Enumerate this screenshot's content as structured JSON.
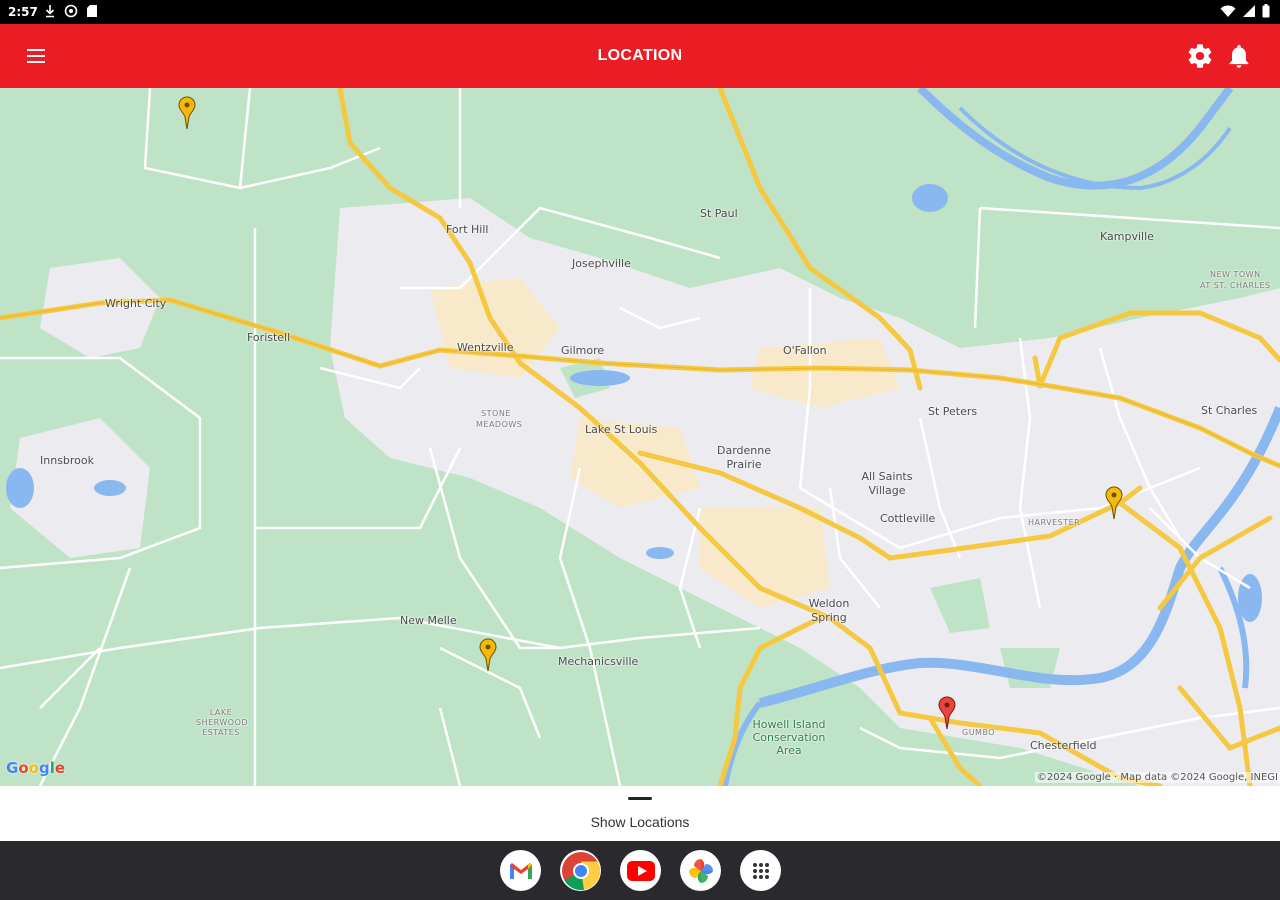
{
  "status_bar": {
    "time": "2:57",
    "left_icons": [
      "download-icon",
      "vpn-icon",
      "sd-card-icon"
    ],
    "right_icons": [
      "wifi-icon",
      "signal-icon",
      "battery-icon"
    ]
  },
  "app_bar": {
    "title": "LOCATION",
    "background": "#ec1c24",
    "icons": [
      "menu-icon",
      "settings-icon",
      "notifications-icon"
    ]
  },
  "map": {
    "places": [
      {
        "id": "fort-hill",
        "name": "Fort Hill"
      },
      {
        "id": "st-paul",
        "name": "St Paul"
      },
      {
        "id": "kampville",
        "name": "Kampville"
      },
      {
        "id": "josephville",
        "name": "Josephville"
      },
      {
        "id": "new-town",
        "name": "NEW TOWN"
      },
      {
        "id": "at-st-charles",
        "name": "AT ST. CHARLES"
      },
      {
        "id": "wright-city",
        "name": "Wright City"
      },
      {
        "id": "foristell",
        "name": "Foristell"
      },
      {
        "id": "wentzville",
        "name": "Wentzville"
      },
      {
        "id": "gilmore",
        "name": "Gilmore"
      },
      {
        "id": "ofallon",
        "name": "O'Fallon"
      },
      {
        "id": "st-peters",
        "name": "St Peters"
      },
      {
        "id": "st-charles",
        "name": "St Charles"
      },
      {
        "id": "stone-meadows",
        "name": "STONE MEADOWS"
      },
      {
        "id": "lake-st-louis",
        "name": "Lake St Louis"
      },
      {
        "id": "innsbrook",
        "name": "Innsbrook"
      },
      {
        "id": "dardenne-prairie",
        "name": "Dardenne Prairie"
      },
      {
        "id": "all-saints-village",
        "name": "All Saints Village"
      },
      {
        "id": "cottleville",
        "name": "Cottleville"
      },
      {
        "id": "harvester",
        "name": "HARVESTER"
      },
      {
        "id": "weldon-spring",
        "name": "Weldon Spring"
      },
      {
        "id": "new-melle",
        "name": "New Melle"
      },
      {
        "id": "mechanicsville",
        "name": "Mechanicsville"
      },
      {
        "id": "lake-sherwood-estates",
        "name": "LAKE SHERWOOD ESTATES"
      },
      {
        "id": "howell-island",
        "name": "Howell Island Conservation Area"
      },
      {
        "id": "gumbo",
        "name": "GUMBO"
      },
      {
        "id": "chesterfield",
        "name": "Chesterfield"
      }
    ],
    "pins": [
      {
        "id": "pin-1",
        "color": "#f6b80d"
      },
      {
        "id": "pin-2",
        "color": "#f6b80d"
      },
      {
        "id": "pin-3",
        "color": "#f6b80d"
      },
      {
        "id": "pin-4",
        "color": "#e8453c"
      }
    ],
    "google_logo": [
      "G",
      "o",
      "o",
      "g",
      "l",
      "e"
    ],
    "attribution": "©2024 Google · Map data ©2024 Google, INEGI"
  },
  "bottom_sheet": {
    "title": "Show Locations"
  },
  "dock": {
    "apps": [
      "gmail-icon",
      "chrome-icon",
      "youtube-icon",
      "photos-icon",
      "app-drawer-icon"
    ]
  }
}
